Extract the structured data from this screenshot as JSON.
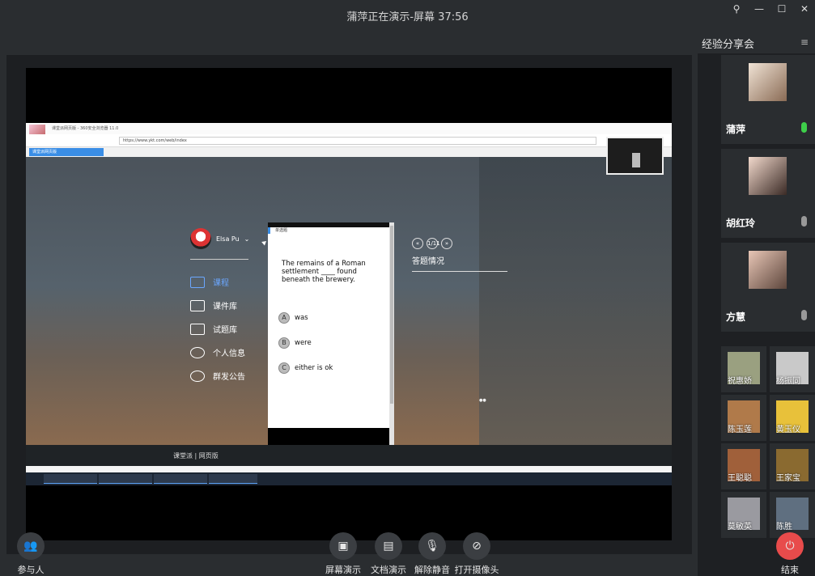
{
  "window": {
    "title": "蒲萍正在演示-屏幕 37:56"
  },
  "window_controls": [
    "pin-icon",
    "minimize-icon",
    "maximize-icon",
    "close-icon"
  ],
  "shared_screen": {
    "browser_title": "课堂派网页版 - 360安全浏览器 11.0",
    "url": "https://www.ykt.com/web/index",
    "tab": "课堂派网页版",
    "user_name": "Elsa Pu",
    "menu": [
      {
        "label": "课程",
        "icon": "course-icon",
        "active": true
      },
      {
        "label": "课件库",
        "icon": "courseware-icon",
        "active": false
      },
      {
        "label": "试题库",
        "icon": "question-bank-icon",
        "active": false
      },
      {
        "label": "个人信息",
        "icon": "profile-icon",
        "active": false
      },
      {
        "label": "群发公告",
        "icon": "globe-icon",
        "active": false
      }
    ],
    "question": "The remains of a Roman settlement ____ found beneath the brewery.",
    "options": [
      {
        "letter": "A",
        "text": "was"
      },
      {
        "letter": "B",
        "text": "were"
      },
      {
        "letter": "C",
        "text": "either is ok"
      }
    ],
    "answer_title": "答题情况",
    "pager": "1/11",
    "footer_brand": "课堂派 | 网页版"
  },
  "sidebar": {
    "title": "经验分享会",
    "speakers": [
      {
        "name": "蒲萍",
        "mic_active": true
      },
      {
        "name": "胡红玲",
        "mic_active": false
      },
      {
        "name": "方慧",
        "mic_active": false
      }
    ],
    "participants": [
      "祝惠娇",
      "杨振同",
      "陈玉莲",
      "黄玉仪",
      "王聪聪",
      "王家宝",
      "莫敏英",
      "陈胜"
    ]
  },
  "toolbar": {
    "participants": "参与人",
    "screen_share": "屏幕演示",
    "doc_share": "文档演示",
    "unmute": "解除静音",
    "camera": "打开摄像头",
    "end": "结束"
  }
}
